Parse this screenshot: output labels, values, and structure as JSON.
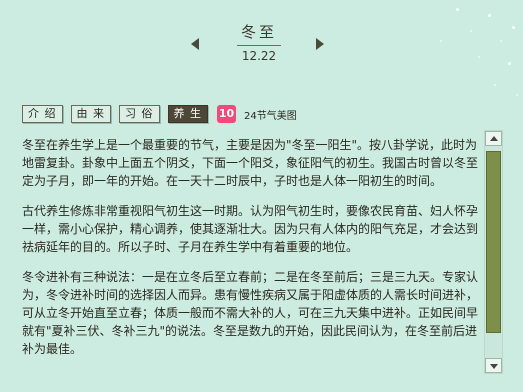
{
  "header": {
    "title": "冬至",
    "date": "12.22"
  },
  "tabs": [
    {
      "label": "介 绍"
    },
    {
      "label": "由 来"
    },
    {
      "label": "习 俗"
    },
    {
      "label": "养 生"
    }
  ],
  "active_tab": "养 生",
  "badge": {
    "text": "10",
    "color": "#f04a7a"
  },
  "gallery_link": "24节气美图",
  "content": {
    "paragraphs": [
      "冬至在养生学上是一个最重要的节气，主要是因为\"冬至一阳生\"。按八卦学说，此时为地雷复卦。卦象中上面五个阴爻，下面一个阳爻，象征阳气的初生。我国古时曾以冬至定为子月，即一年的开始。在一天十二时辰中，子时也是人体一阳初生的时间。",
      "古代养生修炼非常重视阳气初生这一时期。认为阳气初生时，要像农民育苗、妇人怀孕一样，需小心保护，精心调养，使其逐渐壮大。因为只有人体内的阳气充足，才会达到祛病延年的目的。所以子时、子月在养生学中有着重要的地位。",
      "冬令进补有三种说法：一是在立冬后至立春前；二是在冬至前后；三是三九天。专家认为，冬令进补时间的选择因人而异。患有慢性疾病又属于阳虚体质的人需长时间进补，可从立冬开始直至立春；体质一般而不需大补的人，可在三九天集中进补。正如民间早就有\"夏补三伏、冬补三九\"的说法。冬至是数九的开始，因此民间认为，在冬至前后进补为最佳。"
    ]
  },
  "colors": {
    "background": "#ccebe1",
    "active_tab": "#4d4735",
    "scroll_thumb": "#7d8f4a"
  },
  "icons": {
    "prev": "triangle-left",
    "next": "triangle-right",
    "scroll_up": "triangle-up",
    "scroll_down": "triangle-down"
  }
}
